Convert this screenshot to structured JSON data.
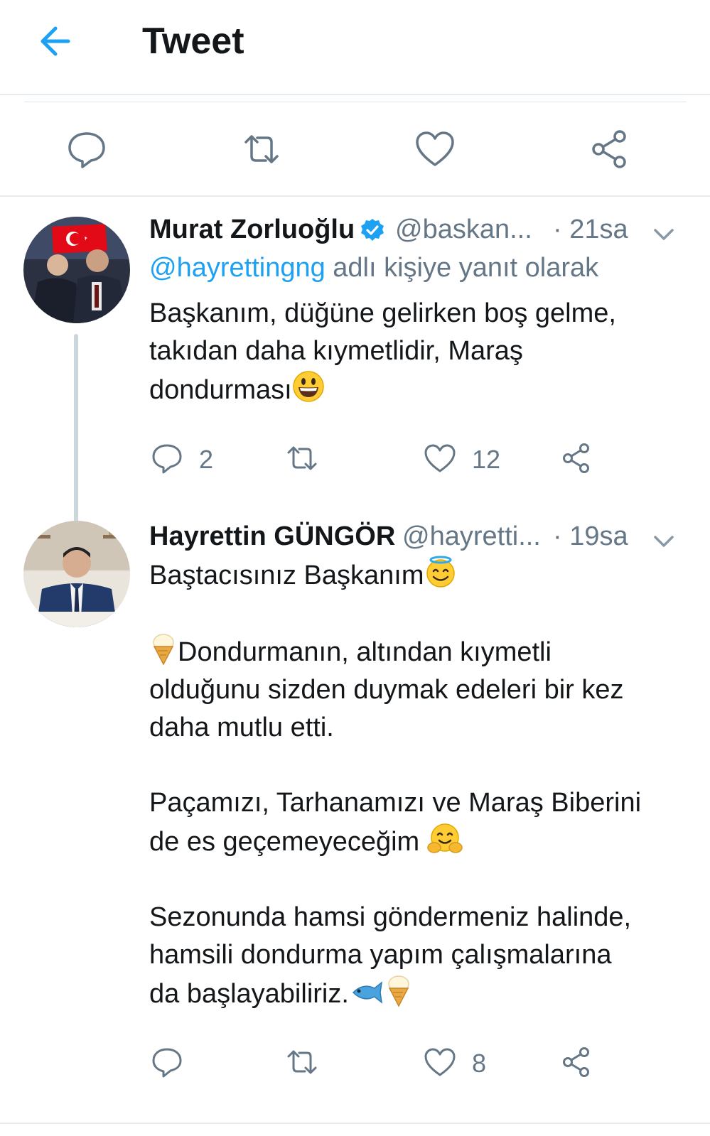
{
  "header": {
    "title": "Tweet"
  },
  "colors": {
    "accent": "#1da1f2",
    "text": "#14171a",
    "muted": "#657786",
    "verified": "#1da1f2"
  },
  "main_tweet_actions": {
    "icons": [
      "reply-icon",
      "retweet-icon",
      "like-icon",
      "share-icon"
    ]
  },
  "tweets": [
    {
      "name": "Murat Zorluoğlu",
      "verified": true,
      "handle": "@baskan...",
      "time": "· 21sa",
      "reply_to_mention": "@hayrettingng",
      "reply_to_suffix": " adlı kişiye yanıt olarak",
      "lines": [
        "Başkanım, düğüne gelirken boş gelme,",
        "takıdan daha kıymetlidir, Maraş",
        "dondurması"
      ],
      "replies": "2",
      "retweets": "",
      "likes": "12"
    },
    {
      "name": "Hayrettin GÜNGÖR",
      "verified": false,
      "handle": "@hayretti...",
      "time": "· 19sa",
      "lines": [
        "Baştacısınız Başkanım",
        "Dondurmanın, altından kıymetli",
        "olduğunu sizden duymak edeleri bir kez",
        "daha mutlu etti.",
        "Paçamızı, Tarhanamızı ve Maraş Biberini",
        "de es geçemeyeceğim",
        "Sezonunda hamsi göndermeniz halinde,",
        "hamsili dondurma yapım çalışmalarına",
        "da başlayabiliriz."
      ],
      "replies": "",
      "retweets": "",
      "likes": "8"
    }
  ]
}
